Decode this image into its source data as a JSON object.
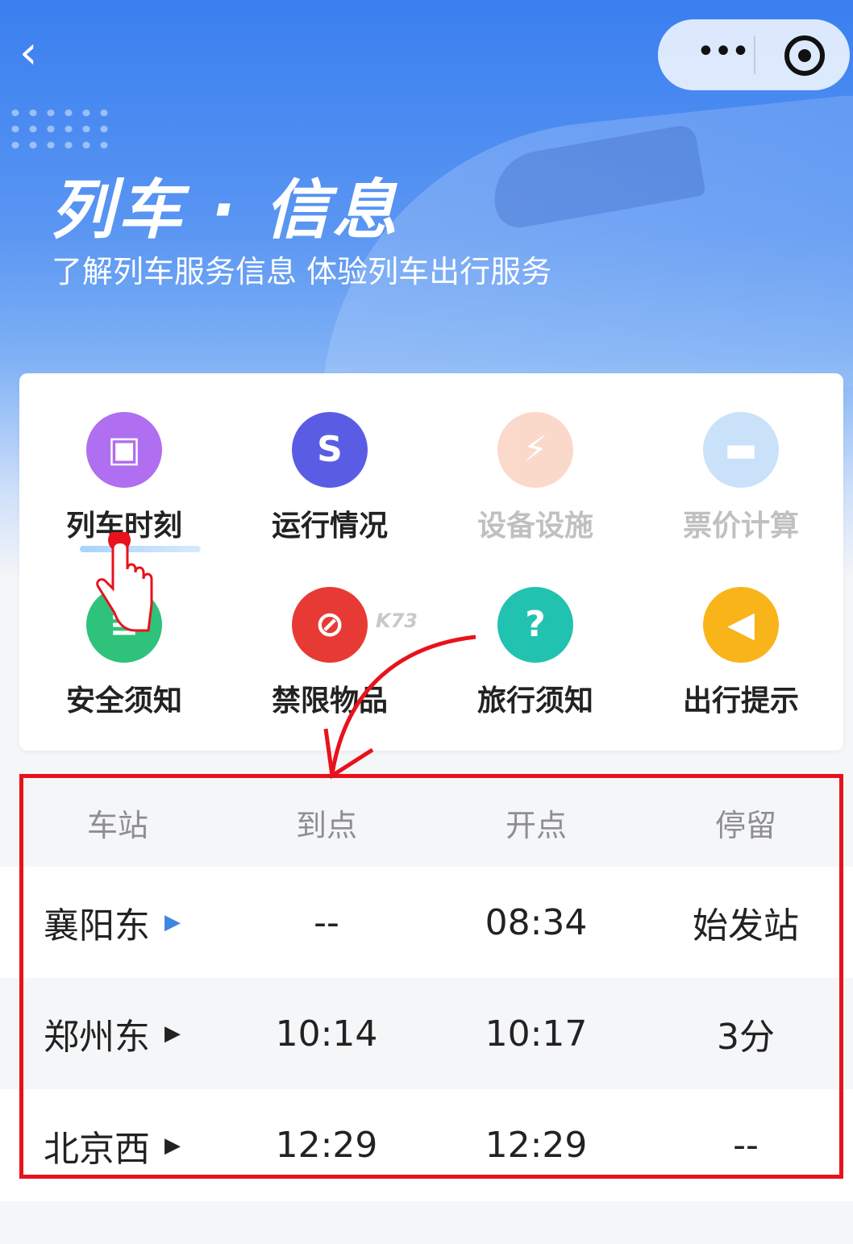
{
  "nav": {
    "back_icon": "‹",
    "more_icon": "•••"
  },
  "hero": {
    "title": "列车 · 信息",
    "subtitle": "了解列车服务信息 体验列车出行服务"
  },
  "menu": [
    {
      "label": "列车时刻",
      "icon": "train-icon",
      "glyph": "▣",
      "color": "#b06ef0",
      "enabled": true,
      "active": true
    },
    {
      "label": "运行情况",
      "icon": "route-icon",
      "glyph": "S",
      "color": "#5a5de4",
      "enabled": true
    },
    {
      "label": "设备设施",
      "icon": "plug-icon",
      "glyph": "⚡",
      "color": "#f5a27e",
      "enabled": false
    },
    {
      "label": "票价计算",
      "icon": "ticket-icon",
      "glyph": "▬",
      "color": "#7db6f5",
      "enabled": false
    },
    {
      "label": "安全须知",
      "icon": "notice-icon",
      "glyph": "≡",
      "color": "#2fc27a",
      "enabled": true
    },
    {
      "label": "禁限物品",
      "icon": "prohibited-luggage-icon",
      "glyph": "⊘",
      "color": "#e83a35",
      "enabled": true
    },
    {
      "label": "旅行须知",
      "icon": "question-bubble-icon",
      "glyph": "?",
      "color": "#22c2b0",
      "enabled": true
    },
    {
      "label": "出行提示",
      "icon": "speaker-icon",
      "glyph": "◀",
      "color": "#f8b419",
      "enabled": true
    }
  ],
  "schedule": {
    "headers": [
      "车站",
      "到点",
      "开点",
      "停留"
    ],
    "rows": [
      {
        "station": "襄阳东",
        "arrive": "--",
        "depart": "08:34",
        "stop": "始发站"
      },
      {
        "station": "郑州东",
        "arrive": "10:14",
        "depart": "10:17",
        "stop": "3分"
      },
      {
        "station": "北京西",
        "arrive": "12:29",
        "depart": "12:29",
        "stop": "--"
      }
    ],
    "row_arrow": "▶"
  },
  "watermark": "K73",
  "colors": {
    "accent_blue": "#3e86e0",
    "highlight_red": "#e8121c"
  }
}
